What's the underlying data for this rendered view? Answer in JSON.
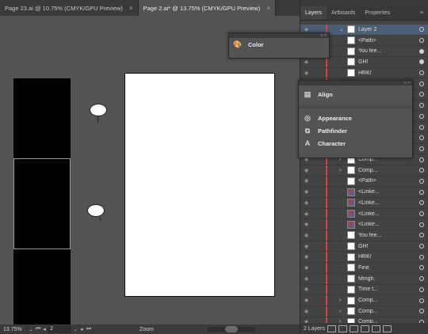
{
  "doc_tabs": [
    {
      "label": "Page 23.ai @ 10.75% (CMYK/GPU Preview)"
    },
    {
      "label": "Page 2.ai* @ 13.75% (CMYK/GPU Preview)"
    }
  ],
  "canvas": {
    "bubble1_text": "",
    "bubble2_text": ""
  },
  "status": {
    "zoom": "13.75%",
    "page": "2",
    "tool": "Zoom"
  },
  "panel": {
    "tabs": [
      "Layers",
      "Artboards",
      "Properties"
    ],
    "layers": [
      {
        "name": "Layer 2",
        "kind": "layer",
        "thumb": "white",
        "target": "empty",
        "chevron": "down"
      },
      {
        "name": "<Path>",
        "kind": "item",
        "thumb": "white",
        "target": "empty"
      },
      {
        "name": "You fee...",
        "kind": "item",
        "thumb": "white",
        "target": "filled"
      },
      {
        "name": "GH!",
        "kind": "item",
        "thumb": "white",
        "target": "filled"
      },
      {
        "name": "HRK!",
        "kind": "item",
        "thumb": "white",
        "target": "empty"
      },
      {
        "name": "",
        "kind": "item",
        "thumb": "white",
        "target": "empty"
      },
      {
        "name": "",
        "kind": "item",
        "thumb": "white",
        "target": "empty"
      },
      {
        "name": "",
        "kind": "item",
        "thumb": "white",
        "target": "empty"
      },
      {
        "name": "",
        "kind": "item",
        "thumb": "white",
        "target": "empty"
      },
      {
        "name": "",
        "kind": "item",
        "thumb": "white",
        "target": "empty"
      },
      {
        "name": "",
        "kind": "item",
        "thumb": "white",
        "target": "empty"
      },
      {
        "name": "",
        "kind": "item",
        "thumb": "white",
        "target": "empty"
      },
      {
        "name": "Comp...",
        "kind": "group",
        "thumb": "white",
        "target": "empty",
        "chevron": "right"
      },
      {
        "name": "Comp...",
        "kind": "group",
        "thumb": "white",
        "target": "empty",
        "chevron": "right"
      },
      {
        "name": "<Path>",
        "kind": "item",
        "thumb": "white",
        "target": "empty"
      },
      {
        "name": "<Linke...",
        "kind": "item",
        "thumb": "img",
        "target": "empty"
      },
      {
        "name": "<Linke...",
        "kind": "item",
        "thumb": "img",
        "target": "empty"
      },
      {
        "name": "<Linke...",
        "kind": "item",
        "thumb": "img",
        "target": "empty"
      },
      {
        "name": "<Linke...",
        "kind": "item",
        "thumb": "img",
        "target": "empty"
      },
      {
        "name": "You fee...",
        "kind": "item",
        "thumb": "white",
        "target": "empty"
      },
      {
        "name": "GH!",
        "kind": "item",
        "thumb": "white",
        "target": "empty"
      },
      {
        "name": "HRK!",
        "kind": "item",
        "thumb": "white",
        "target": "empty"
      },
      {
        "name": "Fine.",
        "kind": "item",
        "thumb": "white",
        "target": "empty"
      },
      {
        "name": "Mmgh.",
        "kind": "item",
        "thumb": "white",
        "target": "empty"
      },
      {
        "name": "Time t...",
        "kind": "item",
        "thumb": "white",
        "target": "empty"
      },
      {
        "name": "Comp...",
        "kind": "group",
        "thumb": "white",
        "target": "empty",
        "chevron": "right"
      },
      {
        "name": "Comp...",
        "kind": "group",
        "thumb": "white",
        "target": "empty",
        "chevron": "right"
      },
      {
        "name": "Comp...",
        "kind": "group",
        "thumb": "white",
        "target": "empty",
        "chevron": "right"
      }
    ],
    "footer_count": "2 Layers"
  },
  "color_panel": {
    "label": "Color"
  },
  "stack_panel": {
    "items": [
      "Align",
      "Appearance",
      "Pathfinder",
      "Character"
    ]
  },
  "colors": {
    "layer_bar": "#e04040",
    "highlight": "#4a5e75"
  }
}
